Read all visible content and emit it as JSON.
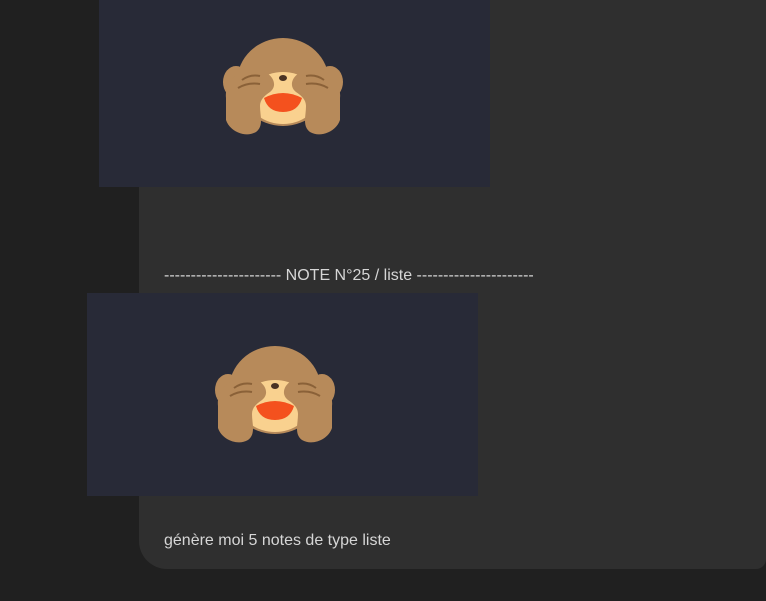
{
  "conversation": {
    "separator_text": "---------------------- NOTE N°25 / liste ----------------------",
    "prompt_text": "génère moi 5 notes de type liste",
    "images": [
      {
        "icon": "see-no-evil-monkey-icon"
      },
      {
        "icon": "see-no-evil-monkey-icon"
      }
    ]
  },
  "colors": {
    "app_background": "#202020",
    "panel_background": "#2f2f2f",
    "image_card_background": "#282a37",
    "text": "#d6d6d6"
  }
}
